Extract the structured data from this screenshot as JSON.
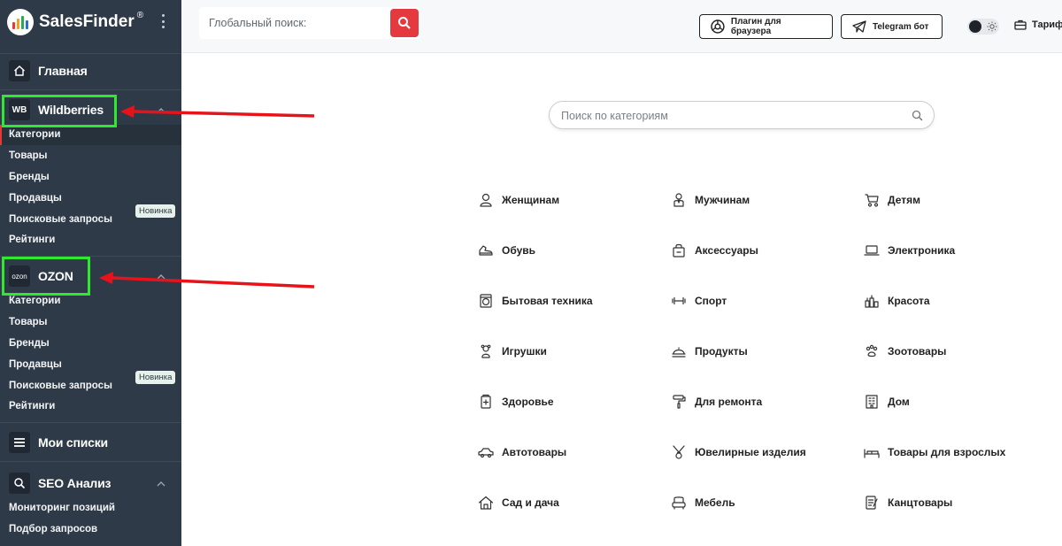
{
  "brand": {
    "name": "SalesFinder",
    "reg": "®"
  },
  "sidebar": {
    "home": "Главная",
    "wildberries": {
      "icon": "WB",
      "title": "Wildberries",
      "items": [
        "Категории",
        "Товары",
        "Бренды",
        "Продавцы",
        "Поисковые запросы",
        "Рейтинги"
      ],
      "badge": "Новинка"
    },
    "ozon": {
      "icon": "ozon",
      "title": "OZON",
      "items": [
        "Категории",
        "Товары",
        "Бренды",
        "Продавцы",
        "Поисковые запросы",
        "Рейтинги"
      ],
      "badge": "Новинка"
    },
    "lists": "Мои списки",
    "seo": {
      "title": "SEO Анализ",
      "items": [
        "Мониторинг позиций",
        "Подбор запросов"
      ]
    }
  },
  "topbar": {
    "search_placeholder": "Глобальный поиск:",
    "plugin_label": "Плагин для браузера",
    "telegram_label": "Telegram бот",
    "tariffs_label": "Тарифы"
  },
  "main": {
    "search_placeholder": "Поиск по категориям",
    "categories": [
      {
        "label": "Женщинам",
        "icon": "woman-icon"
      },
      {
        "label": "Мужчинам",
        "icon": "man-icon"
      },
      {
        "label": "Детям",
        "icon": "stroller-icon"
      },
      {
        "label": "Обувь",
        "icon": "shoe-icon"
      },
      {
        "label": "Аксессуары",
        "icon": "bag-icon"
      },
      {
        "label": "Электроника",
        "icon": "laptop-icon"
      },
      {
        "label": "Бытовая техника",
        "icon": "washer-icon"
      },
      {
        "label": "Спорт",
        "icon": "dumbbell-icon"
      },
      {
        "label": "Красота",
        "icon": "cosmetics-icon"
      },
      {
        "label": "Игрушки",
        "icon": "teddy-icon"
      },
      {
        "label": "Продукты",
        "icon": "food-icon"
      },
      {
        "label": "Зоотовары",
        "icon": "paw-icon"
      },
      {
        "label": "Здоровье",
        "icon": "medicine-icon"
      },
      {
        "label": "Для ремонта",
        "icon": "roller-icon"
      },
      {
        "label": "Дом",
        "icon": "building-icon"
      },
      {
        "label": "Автотовары",
        "icon": "car-icon"
      },
      {
        "label": "Ювелирные изделия",
        "icon": "jewelry-icon"
      },
      {
        "label": "Товары для взрослых",
        "icon": "bed-icon"
      },
      {
        "label": "Сад и дача",
        "icon": "house-icon"
      },
      {
        "label": "Мебель",
        "icon": "armchair-icon"
      },
      {
        "label": "Канцтовары",
        "icon": "notepad-icon"
      }
    ]
  },
  "colors": {
    "sidebar": "#2e3a47",
    "accent": "#e53940",
    "highlight": "#2fe82f",
    "arrow": "#e8121b"
  }
}
